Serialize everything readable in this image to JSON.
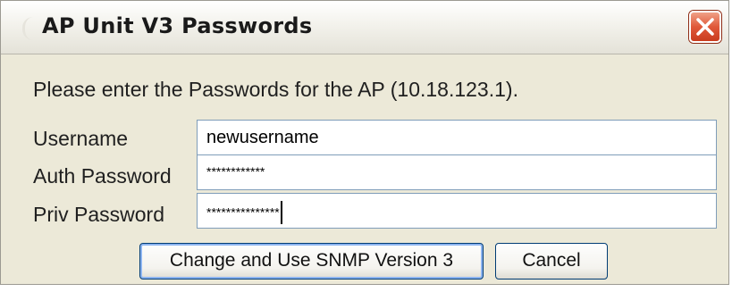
{
  "window": {
    "title": "AP Unit V3 Passwords",
    "close_icon": "close-icon"
  },
  "dialog": {
    "prompt": "Please enter the Passwords for the AP (10.18.123.1).",
    "fields": [
      {
        "label": "Username",
        "value": "newusername"
      },
      {
        "label": "Auth Password",
        "value": "************"
      },
      {
        "label": "Priv Password",
        "value": "***************"
      }
    ]
  },
  "buttons": {
    "primary_label": "Change and Use SNMP Version 3",
    "cancel_label": "Cancel"
  },
  "colors": {
    "dialog_bg": "#ece9d8",
    "close_button": "#e0593a",
    "field_border": "#7f9db9"
  }
}
